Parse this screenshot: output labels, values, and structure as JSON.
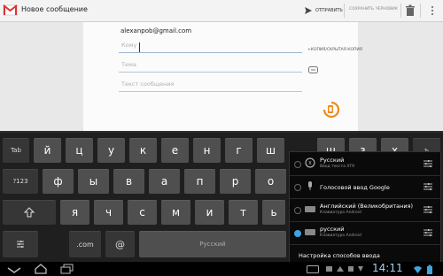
{
  "actionbar": {
    "title": "Новое сообщение",
    "send_label": "ОТПРАВИТЬ",
    "draft_label": "СОХРАНИТЬ ЧЕРНОВИК"
  },
  "compose": {
    "from": "alexanpob@gmail.com",
    "to_placeholder": "Кому",
    "subject_placeholder": "Тема",
    "body_placeholder": "Текст сообщения",
    "ccbcc_label": "+КОПИЯ/СКРЫТАЯ КОПИЯ"
  },
  "keyboard": {
    "row1": [
      "Tab",
      "й",
      "ц",
      "у",
      "к",
      "е",
      "н",
      "г",
      "ш",
      "щ",
      "з",
      "х",
      "ъ"
    ],
    "row2": [
      "?123",
      "ф",
      "ы",
      "в",
      "а",
      "п",
      "р",
      "о",
      "л",
      "д",
      "ж",
      "э"
    ],
    "row3": [
      "я",
      "ч",
      "с",
      "м",
      "и",
      "т",
      "ь",
      "б",
      "ю"
    ],
    "row4": [
      ".com",
      "@",
      "Русский"
    ]
  },
  "input_methods": {
    "options": [
      {
        "title": "Русский",
        "subtitle": "Ввод текста XT9",
        "selected": false
      },
      {
        "title": "Голосовой ввод Google",
        "subtitle": "",
        "selected": false
      },
      {
        "title": "Английский (Великобритания)",
        "subtitle": "Клавиатура Android",
        "selected": false
      },
      {
        "title": "русский",
        "subtitle": "Клавиатура Android",
        "selected": true
      }
    ],
    "footer": "Настройка способов ввода",
    "accent": "#3fa4e0"
  },
  "statusbar": {
    "time": "14:11"
  }
}
